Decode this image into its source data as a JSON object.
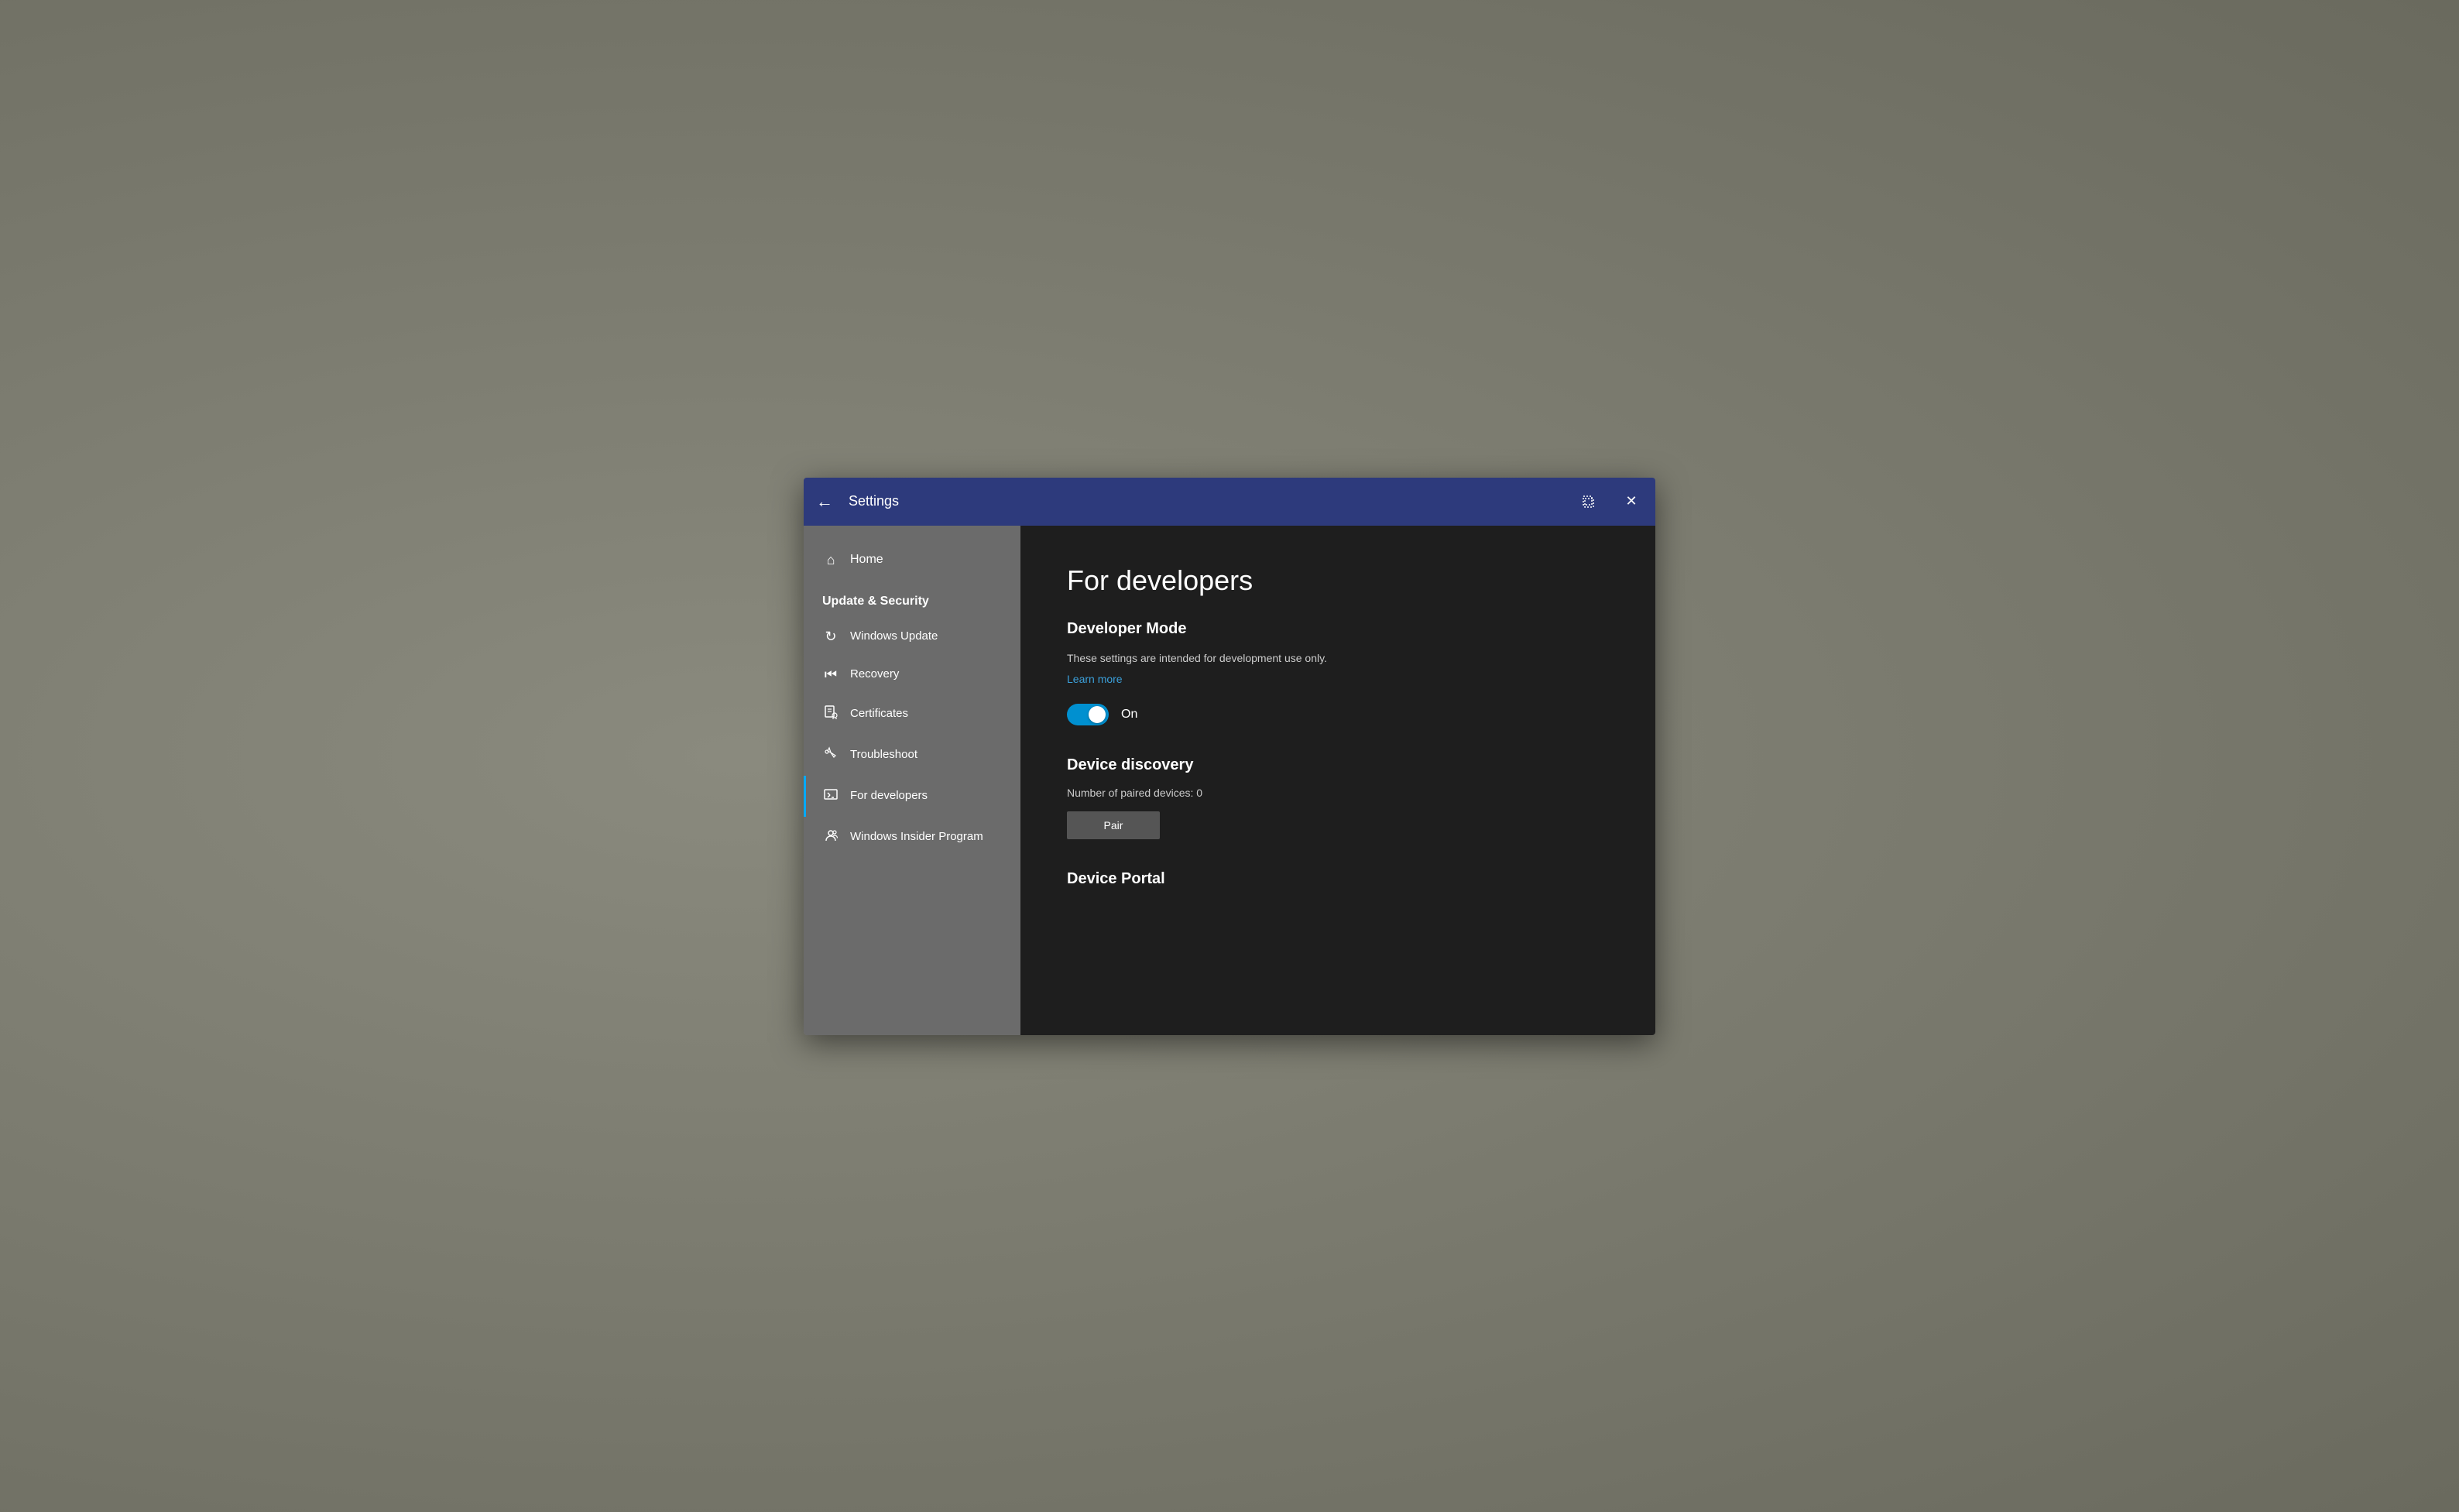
{
  "titlebar": {
    "back_label": "←",
    "title": "Settings",
    "restore_label": "❐",
    "close_label": "✕"
  },
  "sidebar": {
    "home_label": "Home",
    "section_title": "Update & Security",
    "items": [
      {
        "id": "windows-update",
        "label": "Windows Update",
        "icon": "↻",
        "active": false
      },
      {
        "id": "recovery",
        "label": "Recovery",
        "icon": "⏮",
        "active": false
      },
      {
        "id": "certificates",
        "label": "Certificates",
        "icon": "🖹",
        "active": false
      },
      {
        "id": "troubleshoot",
        "label": "Troubleshoot",
        "icon": "🔑",
        "active": false
      },
      {
        "id": "for-developers",
        "label": "For developers",
        "icon": "⚙",
        "active": true
      },
      {
        "id": "windows-insider",
        "label": "Windows Insider Program",
        "icon": "👤",
        "active": false
      }
    ]
  },
  "main": {
    "page_title": "For developers",
    "developer_mode": {
      "section_title": "Developer Mode",
      "description": "These settings are intended for development use only.",
      "learn_more": "Learn more",
      "toggle_state": "On",
      "toggle_on": true
    },
    "device_discovery": {
      "section_title": "Device discovery",
      "paired_label": "Number of paired devices: 0",
      "pair_button": "Pair"
    },
    "device_portal": {
      "section_title": "Device Portal"
    }
  }
}
